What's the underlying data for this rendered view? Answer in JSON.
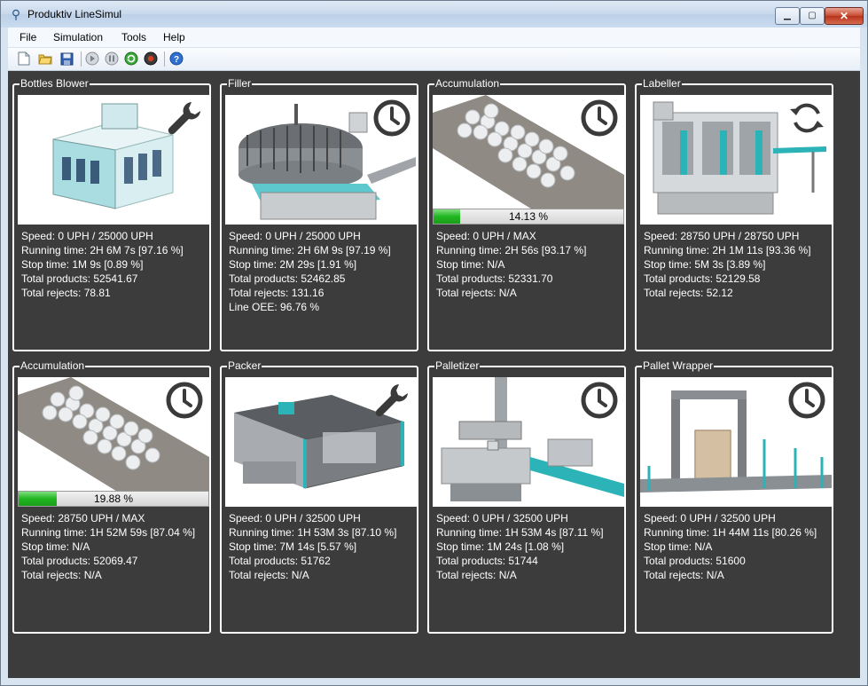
{
  "window": {
    "title": "Produktiv LineSimul"
  },
  "menu": [
    "File",
    "Simulation",
    "Tools",
    "Help"
  ],
  "toolbar_icons": [
    "new-file-icon",
    "open-folder-icon",
    "save-icon",
    "play-icon",
    "pause-icon",
    "refresh-icon",
    "stop-icon",
    "help-icon"
  ],
  "machines": [
    {
      "title": "Bottles Blower",
      "status_icon": "wrench-icon",
      "stats": [
        "Speed: 0 UPH / 25000 UPH",
        "Running time: 2H 6M 7s [97.16 %]",
        "Stop time: 1M 9s [0.89 %]",
        "Total products: 52541.67",
        "Total rejects: 78.81"
      ]
    },
    {
      "title": "Filler",
      "status_icon": "clock-icon",
      "stats": [
        "Speed: 0 UPH / 25000 UPH",
        "Running time: 2H 6M 9s [97.19 %]",
        "Stop time: 2M 29s [1.91 %]",
        "Total products: 52462.85",
        "Total rejects: 131.16",
        "Line OEE: 96.76 %"
      ]
    },
    {
      "title": "Accumulation",
      "status_icon": "clock-icon",
      "progress": {
        "label": "14.13 %",
        "value": 14.13
      },
      "stats": [
        "Speed: 0 UPH / MAX",
        "Running time: 2H 56s [93.17 %]",
        "Stop time: N/A",
        "Total products: 52331.70",
        "Total rejects: N/A"
      ]
    },
    {
      "title": "Labeller",
      "status_icon": "refresh-cycle-icon",
      "stats": [
        "Speed: 28750 UPH / 28750 UPH",
        "Running time: 2H 1M 11s [93.36 %]",
        "Stop time: 5M 3s [3.89 %]",
        "Total products: 52129.58",
        "Total rejects: 52.12"
      ]
    },
    {
      "title": "Accumulation",
      "status_icon": "clock-icon",
      "progress": {
        "label": "19.88 %",
        "value": 19.88
      },
      "stats": [
        "Speed: 28750 UPH / MAX",
        "Running time: 1H 52M 59s [87.04 %]",
        "Stop time: N/A",
        "Total products: 52069.47",
        "Total rejects: N/A"
      ]
    },
    {
      "title": "Packer",
      "status_icon": "wrench-icon",
      "stats": [
        "Speed: 0 UPH / 32500 UPH",
        "Running time: 1H 53M 3s [87.10 %]",
        "Stop time: 7M 14s [5.57 %]",
        "Total products: 51762",
        "Total rejects: N/A"
      ]
    },
    {
      "title": "Palletizer",
      "status_icon": "clock-icon",
      "stats": [
        "Speed: 0 UPH / 32500 UPH",
        "Running time: 1H 53M 4s [87.11 %]",
        "Stop time: 1M 24s [1.08 %]",
        "Total products: 51744",
        "Total rejects: N/A"
      ]
    },
    {
      "title": "Pallet Wrapper",
      "status_icon": "clock-icon",
      "stats": [
        "Speed: 0 UPH / 32500 UPH",
        "Running time: 1H 44M 11s [80.26 %]",
        "Stop time: N/A",
        "Total products: 51600",
        "Total rejects: N/A"
      ]
    }
  ]
}
